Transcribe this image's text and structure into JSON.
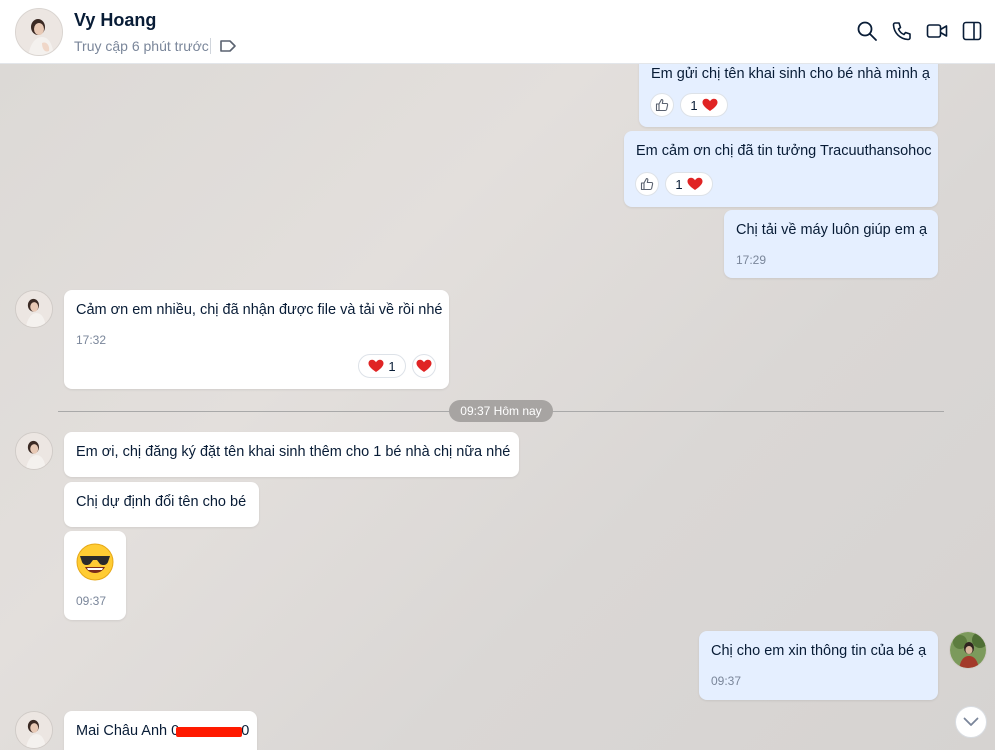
{
  "header": {
    "name": "Vy Hoang",
    "status": "Truy cập 6 phút trước",
    "icons": [
      "search-icon",
      "phone-icon",
      "video-icon",
      "sidebar-toggle-icon"
    ]
  },
  "messages": {
    "m1": {
      "text": "Em gửi chị tên khai sinh cho bé nhà mình ạ",
      "reaction_count": "1"
    },
    "m2": {
      "text": "Em cảm ơn chị đã tin tưởng Tracuuthansohoc",
      "reaction_count": "1"
    },
    "m3": {
      "text": "Chị tải về máy luôn giúp em ạ",
      "time": "17:29"
    },
    "m4": {
      "text": "Cảm ơn em nhiều, chị đã nhận được file và tải về rồi nhé",
      "time": "17:32",
      "reaction_count": "1"
    },
    "divider": "09:37 Hôm nay",
    "m5": {
      "text": "Em ơi, chị đăng ký đặt tên khai sinh thêm cho 1 bé nhà chị nữa nhé"
    },
    "m6": {
      "text": "Chị dự định đổi tên cho bé"
    },
    "m7": {
      "emoji": "😎",
      "time": "09:37"
    },
    "m8": {
      "text": "Chị cho em xin thông tin của bé ạ",
      "time": "09:37"
    },
    "m9": {
      "text_prefix": "Mai Châu Anh 0",
      "text_suffix": "0"
    }
  },
  "colors": {
    "my_bubble": "#e5efff",
    "their_bubble": "#ffffff",
    "heart": "#e02424",
    "redaction": "#ff1a00"
  }
}
